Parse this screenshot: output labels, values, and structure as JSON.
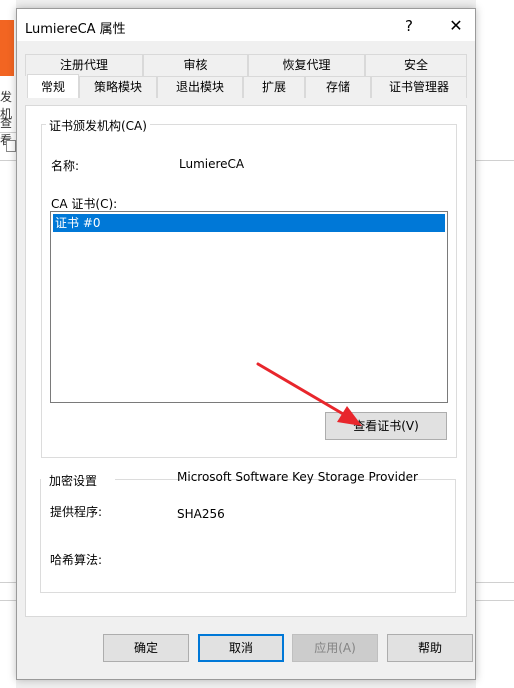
{
  "window": {
    "title": "LumiereCA 属性",
    "help_glyph": "?",
    "close_glyph": "✕"
  },
  "background": {
    "text_1": "发机",
    "text_2": "查看"
  },
  "tabs": {
    "row_back": [
      "注册代理",
      "审核",
      "恢复代理",
      "安全"
    ],
    "row_front": [
      "常规",
      "策略模块",
      "退出模块",
      "扩展",
      "存储",
      "证书管理器"
    ],
    "active": "常规"
  },
  "ca_group": {
    "label": "证书颁发机构(CA)",
    "name_label": "名称:",
    "name_value": "LumiereCA",
    "cert_label": "CA 证书(C):",
    "certificates": [
      "证书 #0"
    ],
    "view_button": "查看证书(V)"
  },
  "crypto_group": {
    "label": "加密设置",
    "provider_label": "提供程序:",
    "provider_value": "Microsoft Software Key Storage Provider",
    "hash_label": "哈希算法:",
    "hash_value": "SHA256"
  },
  "buttons": {
    "ok": "确定",
    "cancel": "取消",
    "apply": "应用(A)",
    "help": "帮助"
  },
  "colors": {
    "selection": "#0078d7",
    "annotation_arrow": "#e8262c"
  }
}
